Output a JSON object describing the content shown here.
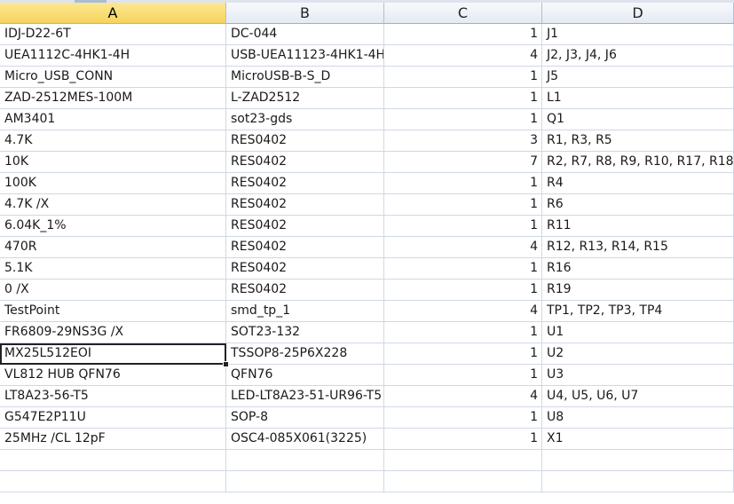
{
  "columns": [
    "A",
    "B",
    "C",
    "D"
  ],
  "active_column": "A",
  "rows": [
    [
      "IDJ-D22-6T",
      "DC-044",
      "1",
      "J1"
    ],
    [
      "UEA1112C-4HK1-4H",
      "USB-UEA11123-4HK1-4H",
      "4",
      "J2, J3, J4, J6"
    ],
    [
      "Micro_USB_CONN",
      "MicroUSB-B-S_D",
      "1",
      "J5"
    ],
    [
      "ZAD-2512MES-100M",
      "L-ZAD2512",
      "1",
      "L1"
    ],
    [
      "AM3401",
      "sot23-gds",
      "1",
      "Q1"
    ],
    [
      "4.7K",
      "RES0402",
      "3",
      "R1, R3, R5"
    ],
    [
      "10K",
      "RES0402",
      "7",
      "R2, R7, R8, R9, R10, R17, R18"
    ],
    [
      "100K",
      "RES0402",
      "1",
      "R4"
    ],
    [
      "4.7K /X",
      "RES0402",
      "1",
      "R6"
    ],
    [
      "6.04K_1%",
      "RES0402",
      "1",
      "R11"
    ],
    [
      "470R",
      "RES0402",
      "4",
      "R12, R13, R14, R15"
    ],
    [
      "5.1K",
      "RES0402",
      "1",
      "R16"
    ],
    [
      "0 /X",
      "RES0402",
      "1",
      "R19"
    ],
    [
      "TestPoint",
      "smd_tp_1",
      "4",
      "TP1, TP2, TP3, TP4"
    ],
    [
      "FR6809-29NS3G /X",
      "SOT23-132",
      "1",
      "U1"
    ],
    [
      "MX25L512EOI",
      "TSSOP8-25P6X228",
      "1",
      "U2"
    ],
    [
      "VL812 HUB QFN76",
      "QFN76",
      "1",
      "U3"
    ],
    [
      "LT8A23-56-T5",
      "LED-LT8A23-51-UR96-T5",
      "4",
      "U4, U5, U6, U7"
    ],
    [
      "G547E2P11U",
      "SOP-8",
      "1",
      "U8"
    ],
    [
      "25MHz /CL 12pF",
      "OSC4-085X061(3225)",
      "1",
      "X1"
    ],
    [
      "",
      "",
      "",
      ""
    ],
    [
      "",
      "",
      "",
      ""
    ]
  ]
}
